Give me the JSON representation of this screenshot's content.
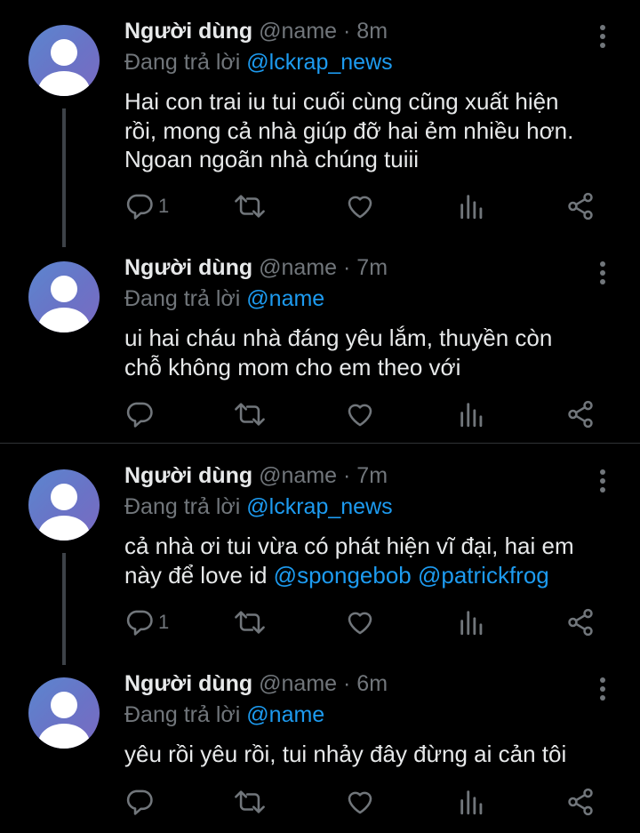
{
  "colors": {
    "background": "#000000",
    "text": "#e7e9ea",
    "secondary": "#71767b",
    "accent": "#1d9bf0"
  },
  "tweets": [
    {
      "name": "Người dùng",
      "handle": "@name",
      "separator": "·",
      "time": "8m",
      "reply_prefix": "Đang trả lời",
      "reply_to": "@lckrap_news",
      "lines": [
        "Hai con trai iu tui cuối cùng cũng xuất hiện",
        "rồi, mong cả nhà giúp đỡ hai ẻm nhiều hơn.",
        "Ngoan ngoãn nhà chúng tuiii"
      ],
      "reply_count": "1"
    },
    {
      "name": "Người dùng",
      "handle": "@name",
      "separator": "·",
      "time": "7m",
      "reply_prefix": "Đang trả lời",
      "reply_to": "@name",
      "lines": [
        "ui hai cháu nhà đáng yêu lắm, thuyền còn",
        "chỗ không mom cho em theo với"
      ],
      "reply_count": ""
    },
    {
      "name": "Người dùng",
      "handle": "@name",
      "separator": "·",
      "time": "7m",
      "reply_prefix": "Đang trả lời",
      "reply_to": "@lckrap_news",
      "line1": "cả nhà ơi tui vừa có phát hiện vĩ đại, hai em",
      "line2_text": "này để love id ",
      "mention1": "@spongebob",
      "mention2": "@patrickfrog",
      "reply_count": "1"
    },
    {
      "name": "Người dùng",
      "handle": "@name",
      "separator": "·",
      "time": "6m",
      "reply_prefix": "Đang trả lời",
      "reply_to": "@name",
      "lines": [
        "yêu rồi yêu rồi, tui nhảy đây đừng ai cản tôi"
      ],
      "reply_count": ""
    }
  ]
}
